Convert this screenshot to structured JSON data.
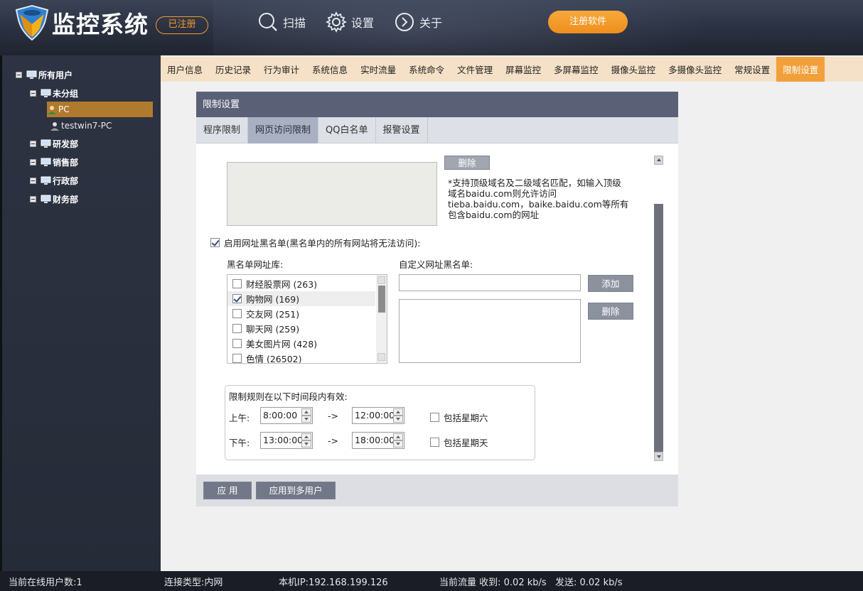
{
  "header": {
    "title": "监控系统",
    "registered_badge": "已注册",
    "scan_label": "扫描",
    "settings_label": "设置",
    "about_label": "关于",
    "register_button": "注册软件",
    "accent_color": "#f39a2b"
  },
  "tree": {
    "root": "所有用户",
    "groups": [
      {
        "label": "未分组",
        "children": [
          "PC",
          "testwin7-PC"
        ]
      },
      {
        "label": "研发部"
      },
      {
        "label": "销售部"
      },
      {
        "label": "行政部"
      },
      {
        "label": "财务部"
      }
    ],
    "selected": "PC"
  },
  "nav_tabs": [
    "用户信息",
    "历史记录",
    "行为审计",
    "系统信息",
    "实时流量",
    "系统命令",
    "文件管理",
    "屏幕监控",
    "多屏幕监控",
    "摄像头监控",
    "多摄像头监控",
    "常规设置",
    "限制设置"
  ],
  "active_nav_tab": "限制设置",
  "panel": {
    "title": "限制设置",
    "sub_tabs": [
      "程序限制",
      "网页访问限制",
      "QQ白名单",
      "报警设置"
    ],
    "active_sub_tab": "网页访问限制"
  },
  "content": {
    "delete_top_label": "删除",
    "note": "*支持顶级域名及二级域名匹配，如输入顶级域名baidu.com则允许访问tieba.baidu.com，baike.baidu.com等所有包含baidu.com的网址",
    "enable_blacklist_label": "启用网址黑名单(黑名单内的所有网站将无法访问):",
    "enable_blacklist_checked": true,
    "blacklist_lib_label": "黑名单网址库:",
    "custom_blacklist_label": "自定义网址黑名单:",
    "lib_items": [
      {
        "label": "财经股票网 (263)",
        "checked": false
      },
      {
        "label": "购物网 (169)",
        "checked": true
      },
      {
        "label": "交友网 (251)",
        "checked": false
      },
      {
        "label": "聊天网 (259)",
        "checked": false
      },
      {
        "label": "美女图片网 (428)",
        "checked": false
      },
      {
        "label": "色情 (26502)",
        "checked": false
      }
    ],
    "custom_input_value": "",
    "add_label": "添加",
    "delete_label": "删除",
    "time_rule_label": "限制规则在以下时间段内有效:",
    "am_label": "上午:",
    "pm_label": "下午:",
    "am_start": "8:00:00",
    "am_end": "12:00:00",
    "pm_start": "13:00:00",
    "pm_end": "18:00:00",
    "arrow": "->",
    "include_saturday": "包括星期六",
    "include_sunday": "包括星期天",
    "apply_label": "应 用",
    "apply_multi_label": "应用到多用户"
  },
  "status": {
    "online_users": "当前在线用户数:1",
    "connection_type": "连接类型:内网",
    "local_ip": "本机IP:192.168.199.126",
    "traffic_recv": "当前流量 收到: 0.02 kb/s",
    "traffic_send": "发送: 0.02 kb/s"
  }
}
